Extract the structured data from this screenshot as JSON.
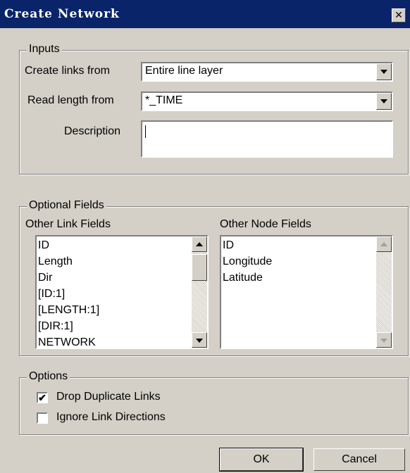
{
  "window": {
    "title": "Create Network",
    "close_glyph": "✕"
  },
  "inputs": {
    "legend": "Inputs",
    "create_links_label": "Create links from",
    "create_links_value": "Entire line layer",
    "read_length_label": "Read length from",
    "read_length_value": "*_TIME",
    "description_label": "Description",
    "description_value": ""
  },
  "optional_fields": {
    "legend": "Optional Fields",
    "link_fields_label": "Other Link Fields",
    "link_fields": [
      "ID",
      "Length",
      "Dir",
      "[ID:1]",
      "[LENGTH:1]",
      "[DIR:1]",
      "NETWORK"
    ],
    "node_fields_label": "Other Node Fields",
    "node_fields": [
      "ID",
      "Longitude",
      "Latitude"
    ]
  },
  "options": {
    "legend": "Options",
    "drop_duplicates_label": "Drop Duplicate Links",
    "drop_duplicates_checked": true,
    "check_glyph": "✔",
    "ignore_directions_label": "Ignore Link Directions",
    "ignore_directions_checked": false
  },
  "buttons": {
    "ok": "OK",
    "cancel": "Cancel"
  }
}
